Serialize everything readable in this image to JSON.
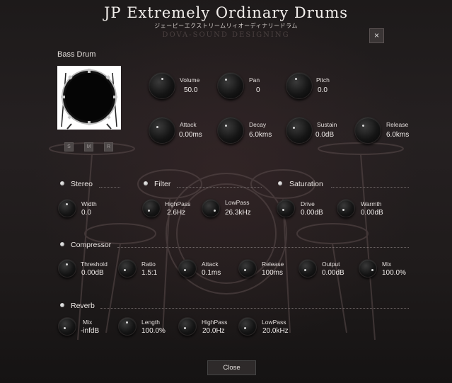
{
  "header": {
    "title": "JP Extremely Ordinary Drums",
    "subtitle": "ジェーピーエクストリームリィオーディナリードラム",
    "brand": "DOVA-SOUND DESIGNING",
    "close_icon": "×"
  },
  "instrument": {
    "name": "Bass Drum",
    "buttons": [
      "S",
      "M",
      "R"
    ]
  },
  "main": {
    "volume": {
      "label": "Volume",
      "value": "50.0"
    },
    "pan": {
      "label": "Pan",
      "value": "0"
    },
    "pitch": {
      "label": "Pitch",
      "value": "0.0"
    },
    "attack": {
      "label": "Attack",
      "value": "0.00ms"
    },
    "decay": {
      "label": "Decay",
      "value": "6.0kms"
    },
    "sustain": {
      "label": "Sustain",
      "value": "0.0dB"
    },
    "release": {
      "label": "Release",
      "value": "6.0kms"
    }
  },
  "stereo": {
    "title": "Stereo",
    "width": {
      "label": "Width",
      "value": "0.0"
    }
  },
  "filter": {
    "title": "Filter",
    "highpass": {
      "label": "HighPass",
      "value": "2.6Hz"
    },
    "lowpass": {
      "label": "LowPass",
      "value": "26.3kHz"
    }
  },
  "saturation": {
    "title": "Saturation",
    "drive": {
      "label": "Drive",
      "value": "0.00dB"
    },
    "warmth": {
      "label": "Warmth",
      "value": "0.00dB"
    }
  },
  "compressor": {
    "title": "Compressor",
    "threshold": {
      "label": "Threshold",
      "value": "0.00dB"
    },
    "ratio": {
      "label": "Ratio",
      "value": "1.5:1"
    },
    "attack": {
      "label": "Attack",
      "value": "0.1ms"
    },
    "release": {
      "label": "Release",
      "value": "100ms"
    },
    "output": {
      "label": "Output",
      "value": "0.00dB"
    },
    "mix": {
      "label": "Mix",
      "value": "100.0%"
    }
  },
  "reverb": {
    "title": "Reverb",
    "mix": {
      "label": "Mix",
      "value": "-infdB"
    },
    "length": {
      "label": "Length",
      "value": "100.0%"
    },
    "highpass": {
      "label": "HighPass",
      "value": "20.0Hz"
    },
    "lowpass": {
      "label": "LowPass",
      "value": "20.0kHz"
    }
  },
  "footer": {
    "close_label": "Close"
  }
}
